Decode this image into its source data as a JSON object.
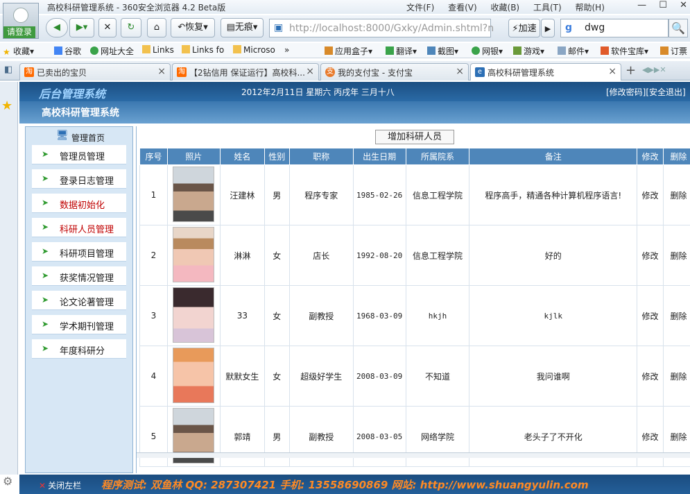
{
  "browser": {
    "title": "高校科研管理系统 - 360安全浏览器 4.2 Beta版",
    "menus": [
      "文件(F)",
      "查看(V)",
      "收藏(B)",
      "工具(T)",
      "帮助(H)"
    ],
    "login_label": "请登录",
    "restore_label": "恢复",
    "incognito_label": "无痕",
    "address": "http://localhost:8000/Gxky/Admin.shtml?n",
    "speed_label": "加速",
    "search_value": "dwg",
    "favbar": {
      "favorites": "收藏",
      "items": [
        "谷歌",
        "网址大全",
        "Links",
        "Links fo",
        "Microso"
      ],
      "more": "»",
      "tools": [
        "应用盒子",
        "翻译",
        "截图",
        "网银",
        "游戏",
        "邮件",
        "软件宝库",
        "订票"
      ]
    },
    "tabs": [
      {
        "label": "已卖出的宝贝",
        "icon": "taobao-icon"
      },
      {
        "label": "【2钻信用 保证运行】高校科...",
        "icon": "taobao-icon"
      },
      {
        "label": "我的支付宝 - 支付宝",
        "icon": "alipay-icon"
      },
      {
        "label": "高校科研管理系统",
        "icon": "ie-icon"
      }
    ]
  },
  "header": {
    "logo": "后台管理系统",
    "date": "2012年2月11日 星期六 丙戌年 三月十八",
    "change_password": "[修改密码]",
    "logout": "[安全退出]",
    "subtitle": "高校科研管理系统"
  },
  "menu": {
    "home": "管理首页",
    "items": [
      {
        "label": "管理员管理"
      },
      {
        "label": "登录日志管理"
      },
      {
        "label": "数据初始化",
        "highlight": true
      },
      {
        "label": "科研人员管理",
        "highlight": true
      },
      {
        "label": "科研项目管理"
      },
      {
        "label": "获奖情况管理"
      },
      {
        "label": "论文论著管理"
      },
      {
        "label": "学术期刊管理"
      },
      {
        "label": "年度科研分"
      }
    ]
  },
  "content": {
    "add_button": "增加科研人员",
    "columns": [
      "序号",
      "照片",
      "姓名",
      "性别",
      "职称",
      "出生日期",
      "所属院系",
      "备注",
      "修改",
      "删除"
    ],
    "rows": [
      {
        "no": "1",
        "name": "汪建林",
        "gender": "男",
        "title": "程序专家",
        "birth": "1985-02-26",
        "dept": "信息工程学院",
        "note": "程序高手，精通各种计算机程序语言!",
        "edit": "修改",
        "del": "删除"
      },
      {
        "no": "2",
        "name": "淋淋",
        "gender": "女",
        "title": "店长",
        "birth": "1992-08-20",
        "dept": "信息工程学院",
        "note": "好的",
        "edit": "修改",
        "del": "删除"
      },
      {
        "no": "3",
        "name": "33",
        "gender": "女",
        "title": "副教授",
        "birth": "1968-03-09",
        "dept": "hkjh",
        "note": "kjlk",
        "edit": "修改",
        "del": "删除"
      },
      {
        "no": "4",
        "name": "默默女生",
        "gender": "女",
        "title": "超级好学生",
        "birth": "2008-03-09",
        "dept": "不知道",
        "note": "我问谁啊",
        "edit": "修改",
        "del": "删除"
      },
      {
        "no": "5",
        "name": "郭靖",
        "gender": "男",
        "title": "副教授",
        "birth": "2008-03-05",
        "dept": "网络学院",
        "note": "老头子了不开化",
        "edit": "修改",
        "del": "删除"
      }
    ]
  },
  "footer": {
    "close_sidebar": "关闭左栏",
    "info": "程序测试: 双鱼林   QQ: 287307421   手机: 13558690869   网站: http://www.shuangyulin.com"
  },
  "colors": {
    "header": "#1c4f82",
    "table_header": "#4e86ba",
    "footer_text": "#ff8a24",
    "highlight": "#c00000"
  }
}
